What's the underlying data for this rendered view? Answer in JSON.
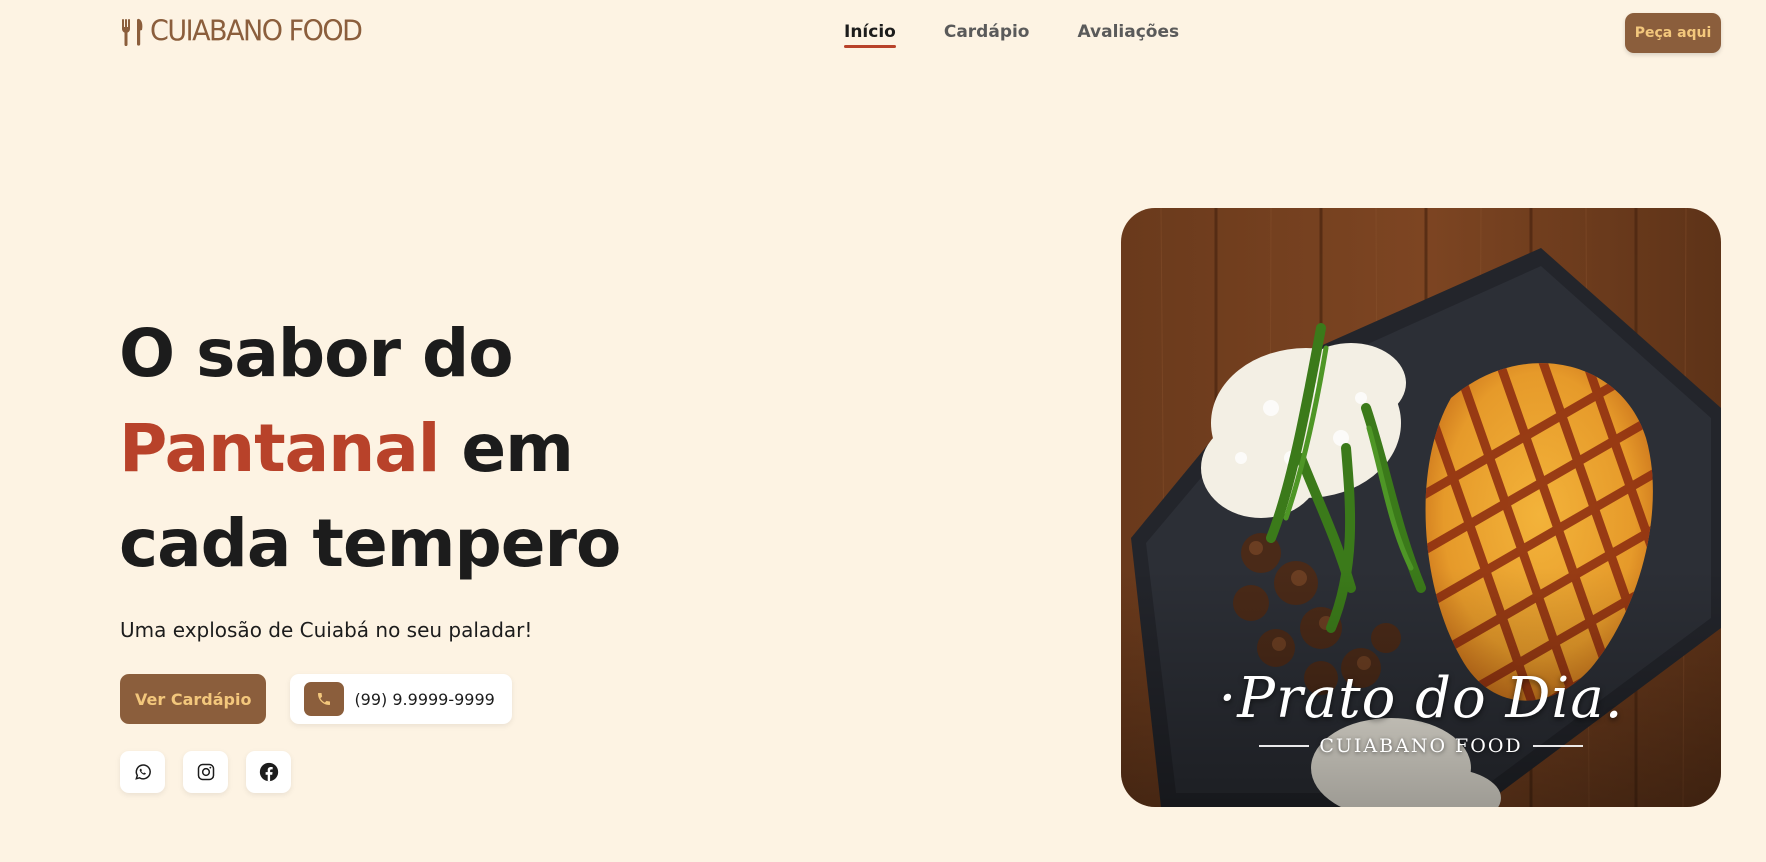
{
  "brand": {
    "name": "CUIABANO FOOD",
    "logo_icon": "fork-knife-icon",
    "color": "#8b5e3c",
    "accent": "#b8422a",
    "background": "#fdf3e3",
    "button_text_color": "#f3c77c"
  },
  "nav": {
    "items": [
      {
        "label": "Início",
        "active": true
      },
      {
        "label": "Cardápio",
        "active": false
      },
      {
        "label": "Avaliações",
        "active": false
      }
    ]
  },
  "header": {
    "order_button": "Peça aqui"
  },
  "hero": {
    "title_line1": "O sabor do",
    "title_accent": "Pantanal",
    "title_line2_rest": " em",
    "title_line3": "cada tempero",
    "subtitle": "Uma explosão de Cuiabá no seu paladar!",
    "menu_button": "Ver Cardápio",
    "phone": "(99) 9.9999-9999",
    "phone_icon": "phone-icon",
    "socials": [
      {
        "icon": "whatsapp-icon"
      },
      {
        "icon": "instagram-icon"
      },
      {
        "icon": "facebook-icon"
      }
    ]
  },
  "dish": {
    "title": "·Prato do Dia.",
    "brand": "CUIABANO FOOD"
  }
}
